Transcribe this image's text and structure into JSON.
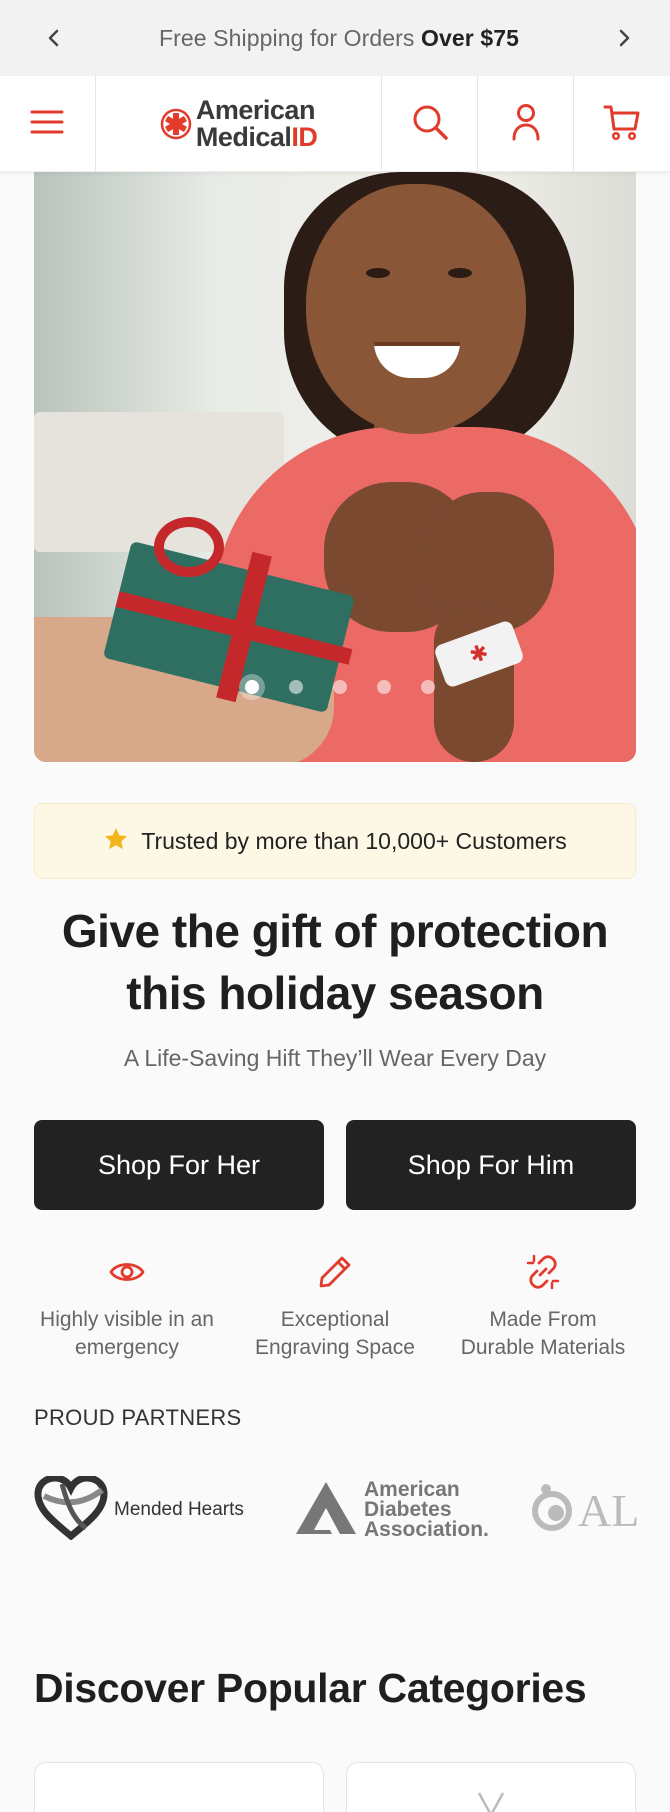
{
  "announcement": {
    "text_prefix": "Free Shipping for Orders ",
    "text_bold": "Over $75"
  },
  "header": {
    "logo_line1": "American",
    "logo_line2": "Medical",
    "logo_id": "ID",
    "icons": [
      "menu-icon",
      "search-icon",
      "account-icon",
      "cart-icon"
    ]
  },
  "hero": {
    "slide_count": 5,
    "active_slide": 1
  },
  "trust": {
    "text": "Trusted by more than 10,000+  Customers"
  },
  "headline": {
    "line1": "Give the gift of protection",
    "line2": "this holiday season",
    "subline": "A Life-Saving Hift They’ll Wear Every Day"
  },
  "buttons": {
    "her": "Shop For Her",
    "him": "Shop For Him"
  },
  "features": [
    {
      "icon": "eye-icon",
      "line1": "Highly visible in an",
      "line2": "emergency"
    },
    {
      "icon": "pencil-icon",
      "line1": "Exceptional",
      "line2": "Engraving Space"
    },
    {
      "icon": "link-icon",
      "line1": "Made From",
      "line2": "Durable Materials"
    }
  ],
  "partners": {
    "title": "PROUD PARTNERS",
    "items": [
      {
        "name": "Mended Hearts"
      },
      {
        "line1": "American",
        "line2": "Diabetes",
        "line3": "Association."
      },
      {
        "name": "AL"
      }
    ]
  },
  "discover": {
    "title": "Discover Popular Categories"
  },
  "colors": {
    "accent": "#e23b2e",
    "dark_button": "#222222",
    "trust_bg": "#fdf8e6",
    "star": "#f3b51b"
  }
}
